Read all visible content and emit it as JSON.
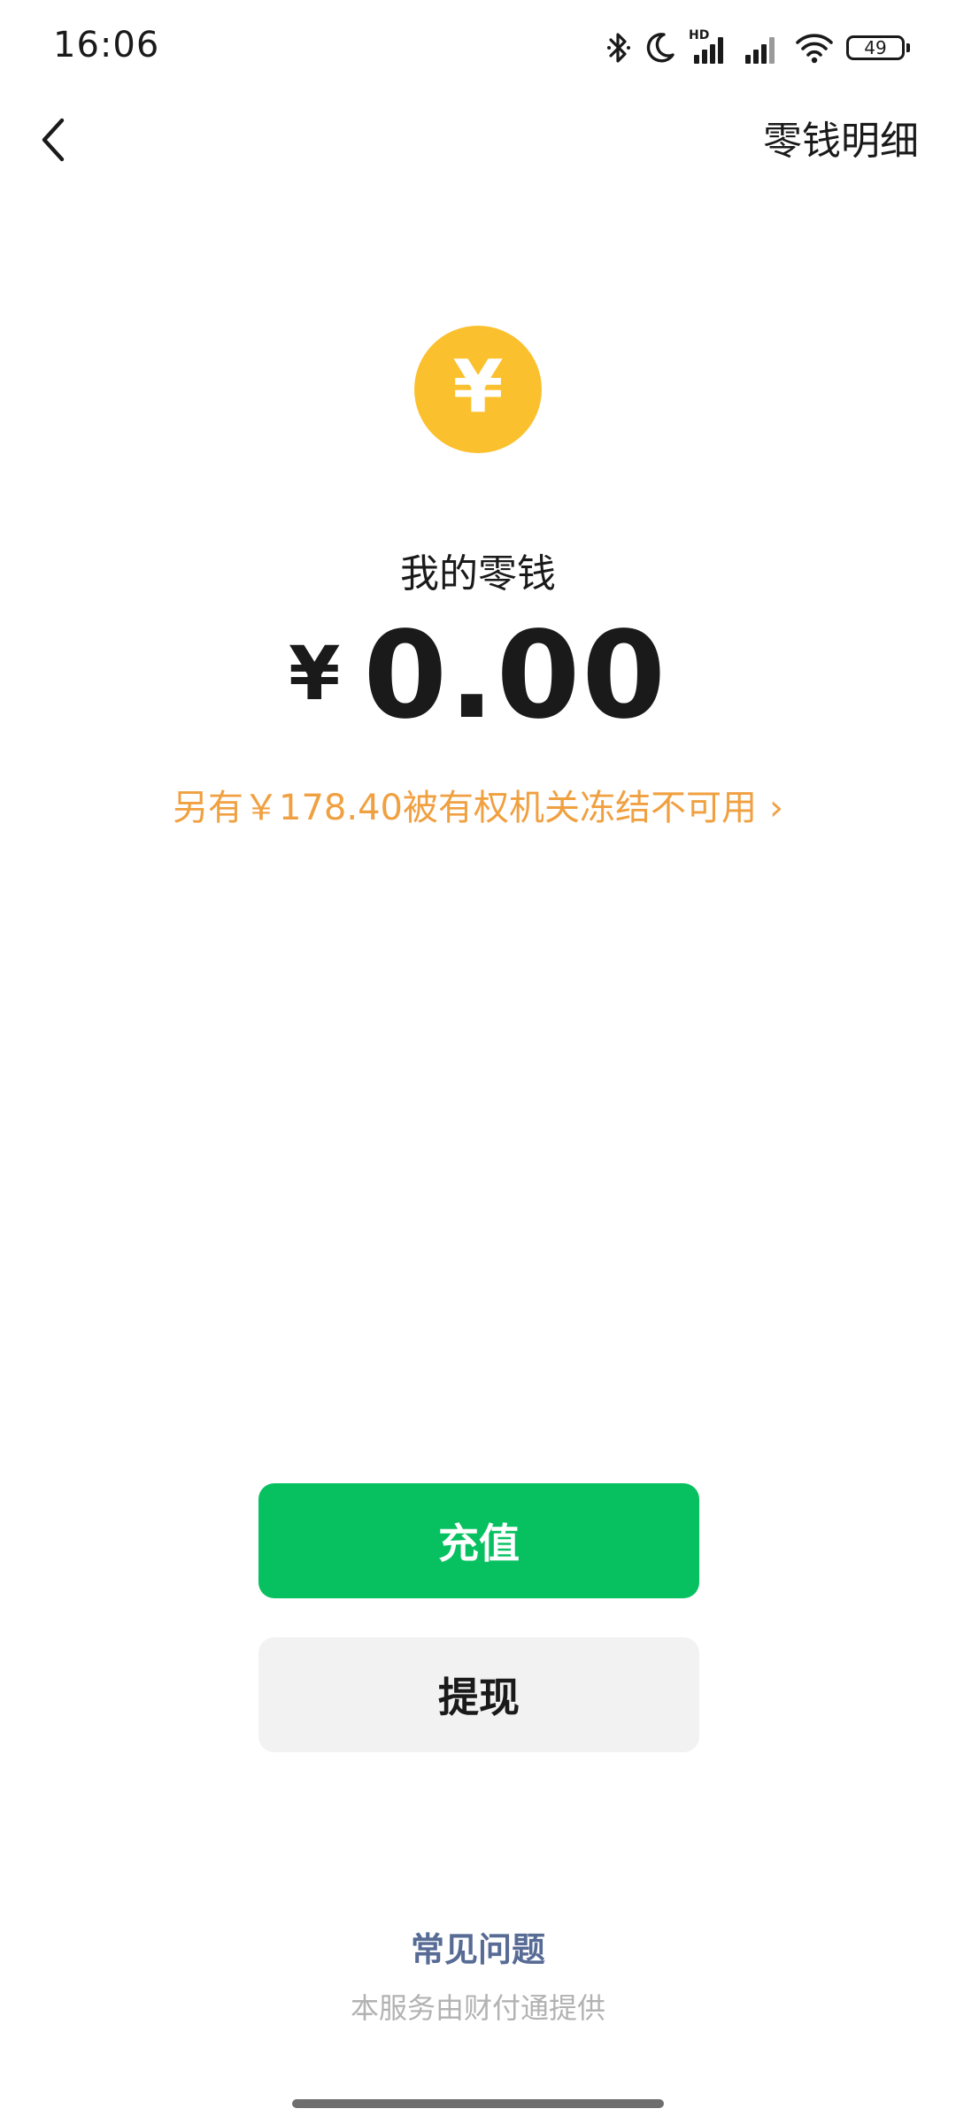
{
  "status_bar": {
    "time": "16:06",
    "hd_label": "HD",
    "battery_level": "49",
    "icons": [
      "bluetooth-icon",
      "do-not-disturb-moon-icon",
      "hd-signal-icon",
      "signal-icon",
      "wifi-icon",
      "battery-icon"
    ]
  },
  "nav": {
    "back_icon": "chevron-left-icon",
    "action_label": "零钱明细"
  },
  "wallet": {
    "coin_icon": "yuan-coin-icon",
    "coin_glyph": "¥",
    "coin_color": "#fbc02d",
    "label": "我的零钱",
    "currency_symbol": "¥",
    "amount": "0.00",
    "frozen_notice": "另有￥178.40被有权机关冻结不可用",
    "frozen_chevron": "›",
    "frozen_color": "#f0a040"
  },
  "actions": {
    "recharge_label": "充值",
    "recharge_color": "#07c160",
    "withdraw_label": "提现"
  },
  "footer": {
    "faq_label": "常见问题",
    "provider_note": "本服务由财付通提供"
  }
}
